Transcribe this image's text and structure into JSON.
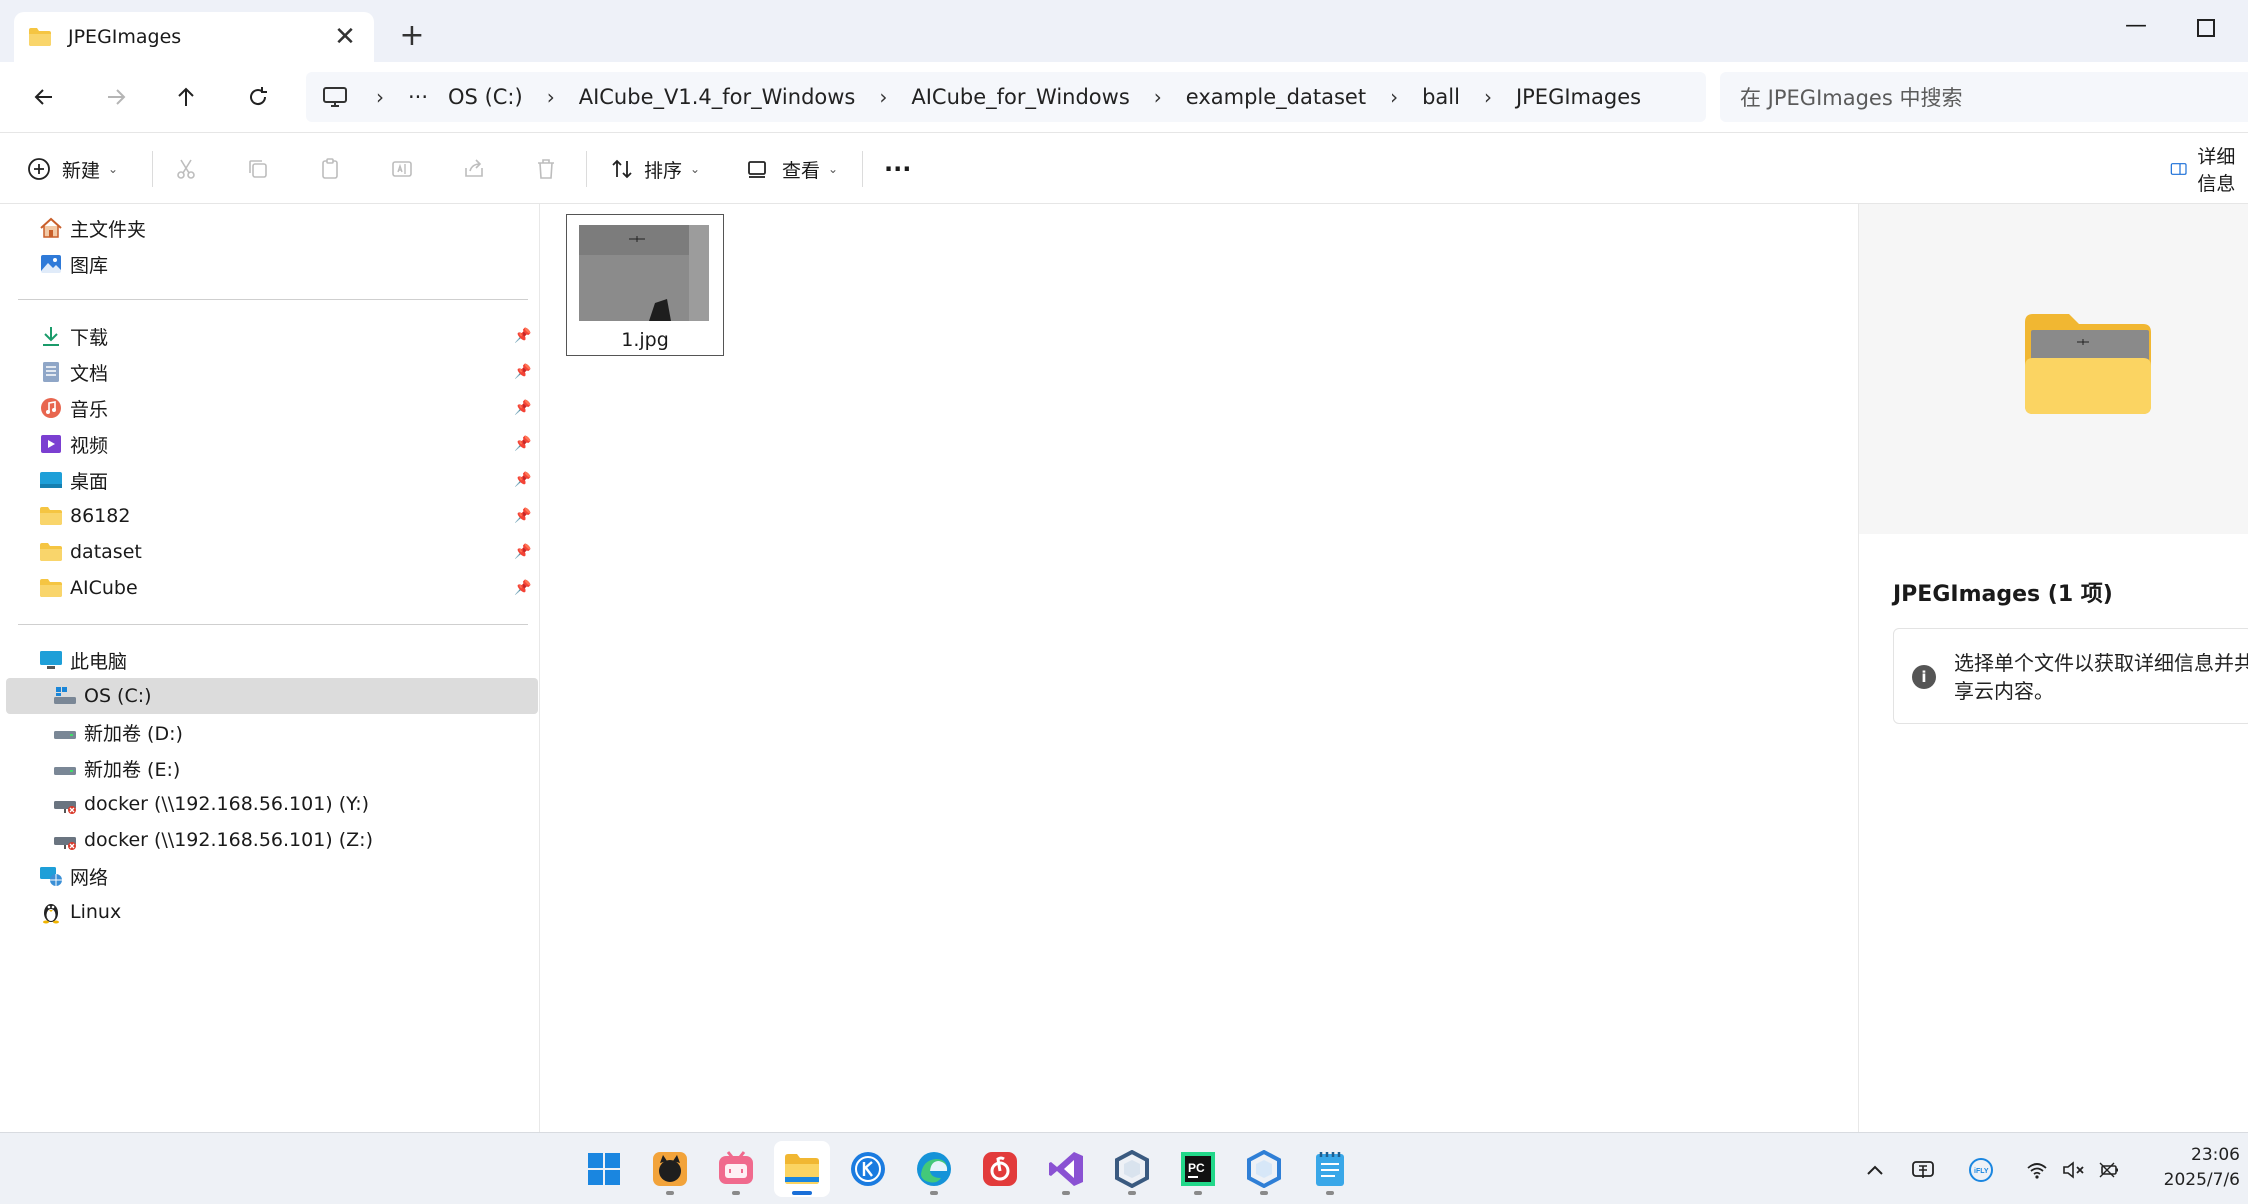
{
  "window": {
    "tab_title": "JPEGImages",
    "tab_close": "✕",
    "new_tab": "+",
    "minimize": "—"
  },
  "nav": {
    "address_more": "···",
    "breadcrumbs": [
      "OS (C:)",
      "AICube_V1.4_for_Windows",
      "AICube_for_Windows",
      "example_dataset",
      "ball",
      "JPEGImages"
    ],
    "search_placeholder": "在 JPEGImages 中搜索"
  },
  "toolbar": {
    "new_label": "新建",
    "sort_label": "排序",
    "view_label": "查看",
    "more_label": "···",
    "details_label": "详细信息"
  },
  "sidebar": {
    "quick": [
      {
        "label": "主文件夹",
        "icon": "home-icon"
      },
      {
        "label": "图库",
        "icon": "gallery-icon"
      }
    ],
    "pinned": [
      {
        "label": "下载",
        "icon": "download-icon"
      },
      {
        "label": "文档",
        "icon": "document-icon"
      },
      {
        "label": "音乐",
        "icon": "music-icon"
      },
      {
        "label": "视频",
        "icon": "video-icon"
      },
      {
        "label": "桌面",
        "icon": "desktop-icon"
      },
      {
        "label": "86182",
        "icon": "folder-icon"
      },
      {
        "label": "dataset",
        "icon": "folder-icon"
      },
      {
        "label": "AICube",
        "icon": "folder-icon"
      }
    ],
    "this_pc": "此电脑",
    "drives": [
      {
        "label": "OS (C:)",
        "icon": "drive-icon",
        "selected": true
      },
      {
        "label": "新加卷 (D:)",
        "icon": "drive-icon",
        "selected": false
      },
      {
        "label": "新加卷 (E:)",
        "icon": "drive-icon",
        "selected": false
      },
      {
        "label": "docker (\\\\192.168.56.101) (Y:)",
        "icon": "network-drive-icon",
        "selected": false
      },
      {
        "label": "docker (\\\\192.168.56.101) (Z:)",
        "icon": "network-drive-icon",
        "selected": false
      }
    ],
    "network": "网络",
    "linux": "Linux"
  },
  "content": {
    "files": [
      {
        "name": "1.jpg",
        "type": "image"
      }
    ]
  },
  "details": {
    "title": "JPEGImages (1 项)",
    "info": "选择单个文件以获取详细信息并共享云内容。"
  },
  "taskbar": {
    "apps": [
      "start-icon",
      "cat-app-icon",
      "bilibili-icon",
      "file-explorer-icon",
      "k-app-icon",
      "edge-icon",
      "netease-music-icon",
      "visual-studio-icon",
      "hex-app-icon",
      "pycharm-icon",
      "hex-app-2-icon",
      "notepad-icon"
    ],
    "active_app": "file-explorer-icon",
    "clock_time": "23:06",
    "clock_date": "2025/7/6"
  },
  "colors": {
    "accent": "#1a6fd8",
    "folder": "#f5c542",
    "selection": "#dcdcdc"
  }
}
